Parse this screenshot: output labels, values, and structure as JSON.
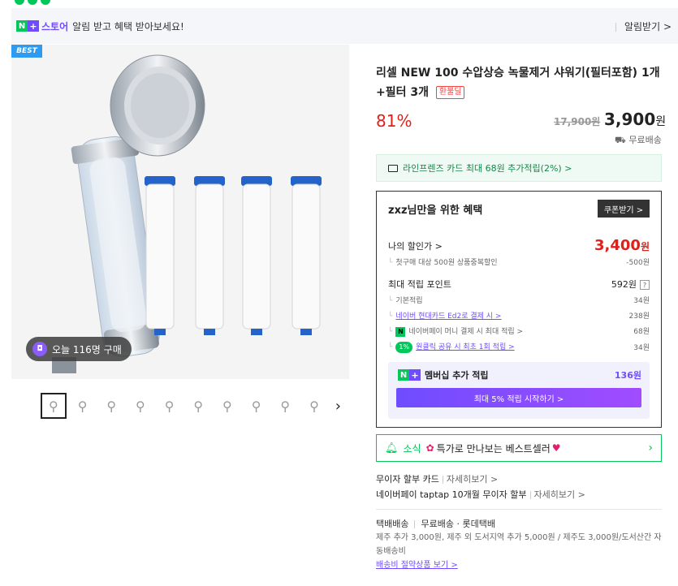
{
  "alert": {
    "store_label": "스토어",
    "message": "알림 받고 혜택 받아보세요!",
    "button": "알림받기 >"
  },
  "gallery": {
    "best_badge": "BEST",
    "buyers_today": "오늘 116명 구매",
    "thumb_count": 10
  },
  "product": {
    "title": "리셀 NEW 100 수압상승 녹물제거 샤워기(필터포함) 1개+필터 3개",
    "refurb_tag": "환불딜",
    "discount": "81%",
    "original_price": "17,900원",
    "price": "3,900",
    "price_unit": "원",
    "shipping": "무료배송"
  },
  "card_benefit": "라인프렌즈 카드 최대 68원 추가적립(2%) >",
  "benefits": {
    "header": "zxz님만을 위한 혜택",
    "coupon_button": "쿠폰받기 >",
    "my_price_label": "나의 할인가 >",
    "my_price": "3,400",
    "my_price_unit": "원",
    "first_purchase": "첫구매 대상 500원 상품중복할인",
    "first_purchase_amt": "-500원",
    "max_points_label": "최대 적립 포인트",
    "max_points": "592원",
    "point_rows": [
      {
        "label": "기본적립",
        "value": "34원"
      },
      {
        "label": "네이버 현대카드 Ed2로 결제 시 >",
        "value": "238원"
      },
      {
        "label": "네이버페이 머니 결제 시 최대 적립 >",
        "value": "68원"
      },
      {
        "label": "원클릭 공유 시 최초 1회 적립 >",
        "value": "34원"
      }
    ],
    "pill_label": "1%",
    "member_label": "멤버십 추가 적립",
    "member_amount": "136원",
    "member_button": "최대 5% 적립 시작하기 >"
  },
  "news": {
    "label": "소식",
    "text": "특가로 만나보는 베스트셀러"
  },
  "installment": [
    {
      "label": "무이자 할부 카드",
      "more": "자세히보기 >"
    },
    {
      "label": "네이버페이 taptap 10개월 무이자 할부",
      "more": "자세히보기 >"
    }
  ],
  "delivery": {
    "type": "택배배송",
    "detail": "무료배송 · 롯데택배",
    "note": "제주 추가 3,000원, 제주 외 도서지역 추가 5,000원 / 제주도 3,000원/도서산간 자동배송비",
    "link": "배송비 절약상품 보기 >"
  },
  "colors": {
    "accent_green": "#03c75a",
    "accent_purple": "#6f4cff",
    "price_red": "#e0201b"
  }
}
